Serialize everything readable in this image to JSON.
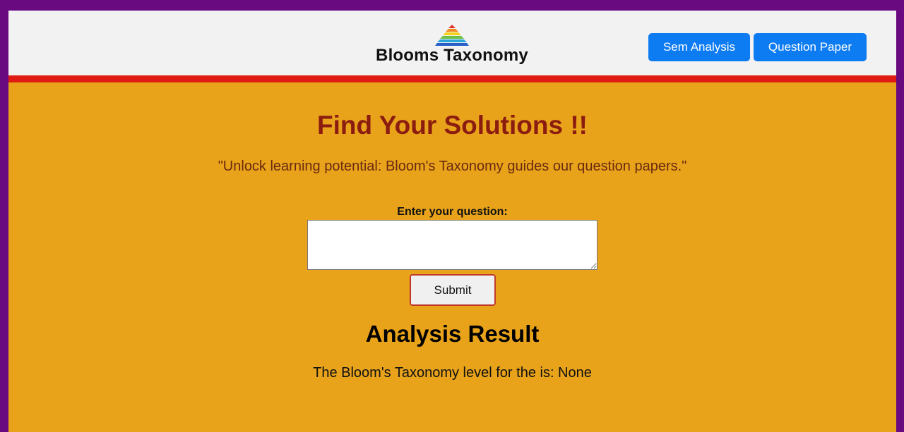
{
  "header": {
    "brand_title": "Blooms Taxonomy",
    "logo_icon": "pyramid-icon",
    "nav": {
      "sem_analysis_label": "Sem Analysis",
      "question_paper_label": "Question Paper"
    }
  },
  "main": {
    "heading": "Find Your Solutions !!",
    "tagline": "\"Unlock learning potential: Bloom's Taxonomy guides our question papers.\"",
    "form": {
      "question_label": "Enter your question:",
      "question_value": "",
      "submit_label": "Submit"
    },
    "result": {
      "heading": "Analysis Result",
      "text": "The Bloom's Taxonomy level for the is: None"
    }
  },
  "colors": {
    "outer_border": "#6a0a80",
    "page_background": "#e8a31b",
    "header_background": "#f2f2f2",
    "header_accent_bar": "#e01b14",
    "nav_button": "#0d7cf2",
    "heading": "#8b1c10",
    "tagline": "#6b2a10"
  }
}
